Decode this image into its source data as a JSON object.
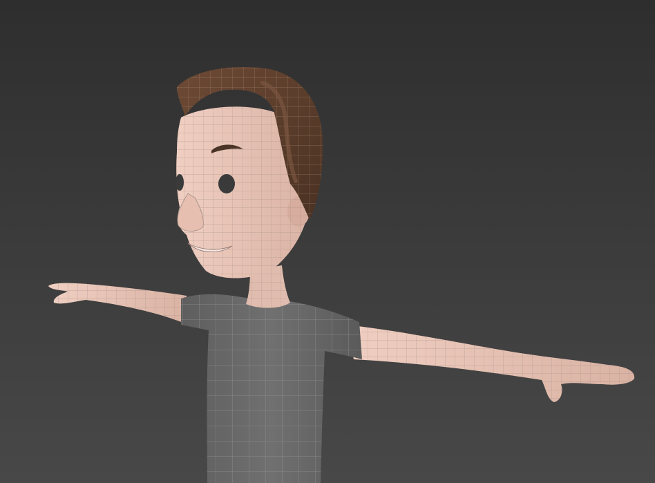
{
  "viewport": {
    "kind": "3d-perspective-viewport",
    "display_mode": "shaded-with-wireframe"
  },
  "model": {
    "subject": "cartoon-character-t-pose",
    "colors": {
      "background_top": "#2e2e2e",
      "background_bottom": "#484848",
      "skin": "#e8c4b6",
      "skin_shadow": "#c9a193",
      "hair": "#5a3d2b",
      "hair_highlight": "#7a5640",
      "shirt": "#6a6a6a",
      "shirt_shadow": "#555555",
      "eye": "#3a3a3a",
      "eyebrow": "#4a3428",
      "wire_skin": "#a58f88",
      "wire_shirt": "#9a9a9a",
      "wire_hair": "#b59a86"
    }
  }
}
